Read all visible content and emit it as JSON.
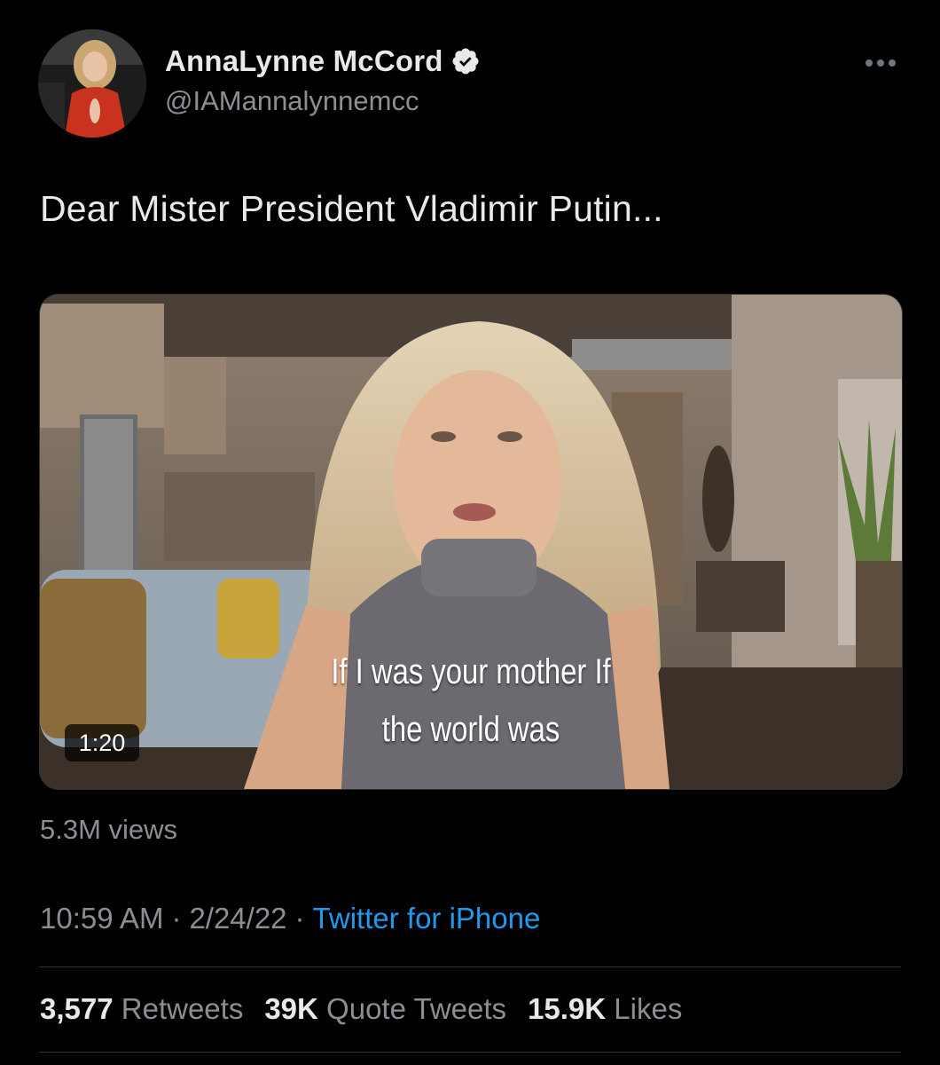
{
  "author": {
    "display_name": "AnnaLynne McCord",
    "handle": "@IAMannalynnemcc",
    "verified_icon": "verified-badge-icon",
    "verified_color": "#e7e9ea"
  },
  "tweet": {
    "text": "Dear Mister President Vladimir Putin..."
  },
  "media": {
    "caption_line_1": "If I was your mother If",
    "caption_line_2": "the world was",
    "duration": "1:20"
  },
  "views": "5.3M views",
  "meta": {
    "time": "10:59 AM",
    "separator": "·",
    "date": "2/24/22",
    "source": "Twitter for iPhone"
  },
  "stats": {
    "retweets_count": "3,577",
    "retweets_label": "Retweets",
    "quotes_count": "39K",
    "quotes_label": "Quote Tweets",
    "likes_count": "15.9K",
    "likes_label": "Likes"
  },
  "colors": {
    "background": "#000000",
    "text_primary": "#e7e9ea",
    "text_secondary": "#8b8f94",
    "link": "#1d9bf0",
    "divider": "#2f3336"
  }
}
